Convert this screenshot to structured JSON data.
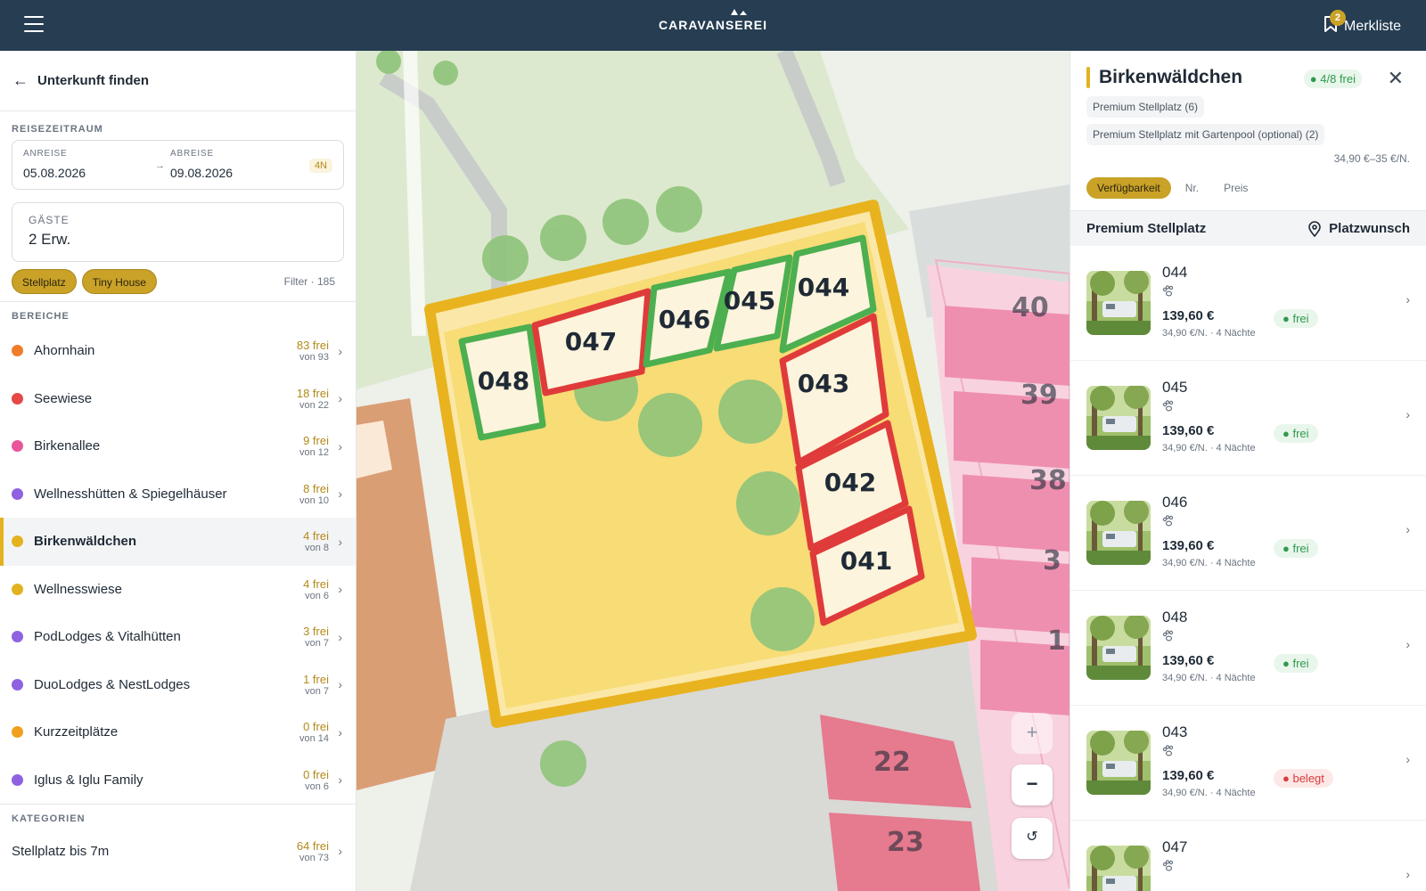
{
  "topbar": {
    "brand": "CARAVANSEREI",
    "merkliste_label": "Merkliste",
    "merkliste_count": "2"
  },
  "sidebar": {
    "back_label": "Unterkunft finden",
    "reisezeitraum_label": "REISEZEITRAUM",
    "anreise_label": "ANREISE",
    "anreise_value": "05.08.2026",
    "abreise_label": "ABREISE",
    "abreise_value": "09.08.2026",
    "nights": "4N",
    "gaeste_label": "GÄSTE",
    "gaeste_value": "2 Erw.",
    "chips": [
      "Stellplatz",
      "Tiny House"
    ],
    "filter_count": "Filter · 185",
    "bereiche_label": "BEREICHE",
    "areas": [
      {
        "name": "Ahornhain",
        "free": "83 frei",
        "of": "von 93",
        "color": "#f07d2a"
      },
      {
        "name": "Seewiese",
        "free": "18 frei",
        "of": "von 22",
        "color": "#e64747"
      },
      {
        "name": "Birkenallee",
        "free": "9 frei",
        "of": "von 12",
        "color": "#e8559a"
      },
      {
        "name": "Wellnesshütten & Spiegelhäuser",
        "free": "8 frei",
        "of": "von 10",
        "color": "#8e62e0"
      },
      {
        "name": "Birkenwäldchen",
        "free": "4 frei",
        "of": "von 8",
        "color": "#e3b21f",
        "active": true
      },
      {
        "name": "Wellnesswiese",
        "free": "4 frei",
        "of": "von 6",
        "color": "#e3b21f"
      },
      {
        "name": "PodLodges & Vitalhütten",
        "free": "3 frei",
        "of": "von 7",
        "color": "#8e62e0"
      },
      {
        "name": "DuoLodges & NestLodges",
        "free": "1 frei",
        "of": "von 7",
        "color": "#8e62e0"
      },
      {
        "name": "Kurzzeitplätze",
        "free": "0 frei",
        "of": "von 14",
        "color": "#f0a01e"
      },
      {
        "name": "Iglus & Iglu Family",
        "free": "0 frei",
        "of": "von 6",
        "color": "#8e62e0"
      }
    ],
    "kategorien_label": "KATEGORIEN",
    "categories": [
      {
        "name": "Stellplatz bis 7m",
        "free": "64 frei",
        "of": "von 73"
      }
    ]
  },
  "map": {
    "pitch_labels": [
      "048",
      "047",
      "046",
      "045",
      "044",
      "043",
      "042",
      "041"
    ],
    "neighbor_labels": [
      "40",
      "39",
      "38",
      "3",
      "1",
      "22",
      "23"
    ],
    "zoom_in": "+",
    "zoom_out": "−",
    "reset": "↺"
  },
  "panel": {
    "title": "Birkenwäldchen",
    "free_badge": "4/8 frei",
    "tags": [
      "Premium Stellplatz (6)",
      "Premium Stellplatz mit Gartenpool (optional) (2)"
    ],
    "price_range": "34,90 €–35 €/N.",
    "sort_options": [
      "Verfügbarkeit",
      "Nr.",
      "Preis"
    ],
    "group_title": "Premium Stellplatz",
    "platzwunsch": "Platzwunsch",
    "pitches": [
      {
        "no": "044",
        "price": "139,60 €",
        "sub": "34,90 €/N. · 4 Nächte",
        "status": "frei"
      },
      {
        "no": "045",
        "price": "139,60 €",
        "sub": "34,90 €/N. · 4 Nächte",
        "status": "frei"
      },
      {
        "no": "046",
        "price": "139,60 €",
        "sub": "34,90 €/N. · 4 Nächte",
        "status": "frei"
      },
      {
        "no": "048",
        "price": "139,60 €",
        "sub": "34,90 €/N. · 4 Nächte",
        "status": "frei"
      },
      {
        "no": "043",
        "price": "139,60 €",
        "sub": "34,90 €/N. · 4 Nächte",
        "status": "belegt"
      },
      {
        "no": "047",
        "price": "",
        "sub": "",
        "status": ""
      }
    ]
  },
  "colors": {
    "topbar": "#263d52",
    "accent": "#c9a227",
    "free": "#2f9a4d",
    "occupied": "#d83a3a"
  }
}
